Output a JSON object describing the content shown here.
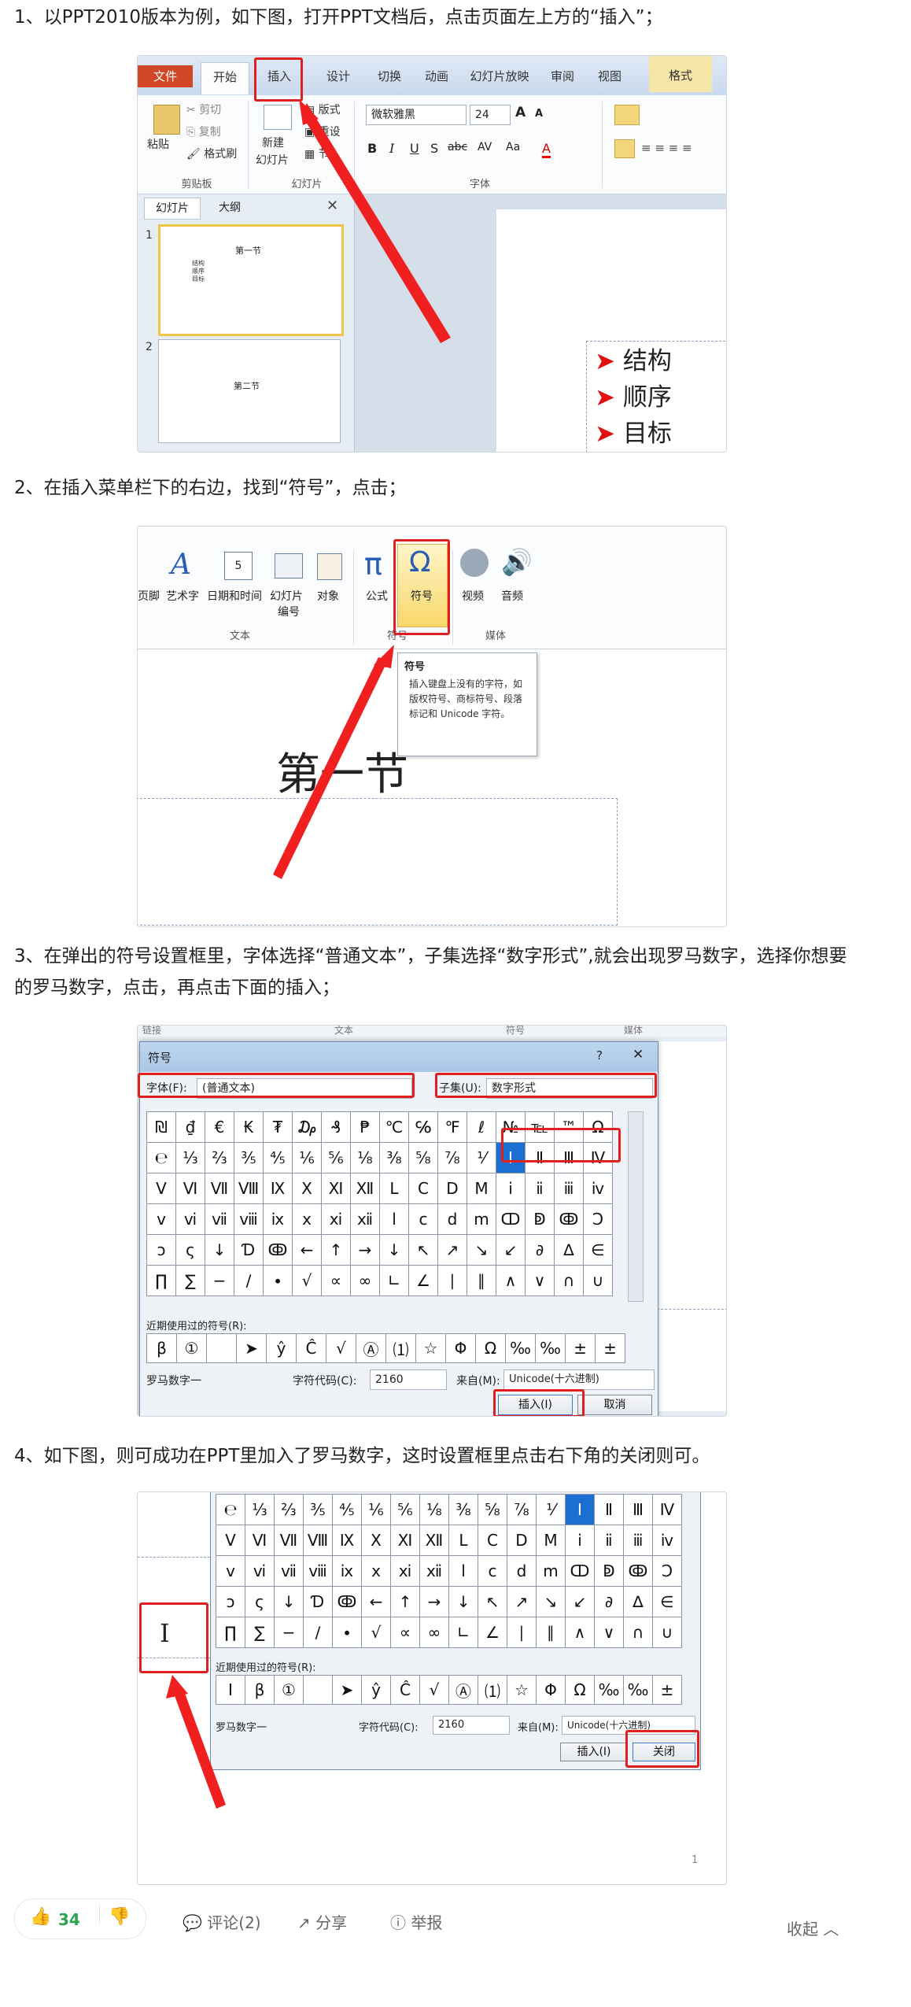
{
  "steps": [
    "1、以PPT2010版本为例，如下图，打开PPT文档后，点击页面左上方的“插入”；",
    "2、在插入菜单栏下的右边，找到“符号”，点击；",
    "3、在弹出的符号设置框里，字体选择“普通文本”，子集选择“数字形式”,就会出现罗马数字，选择你想要的罗马数字，点击，再点击下面的插入；",
    "4、如下图，则可成功在PPT里加入了罗马数字，这时设置框里点击右下角的关闭则可。"
  ],
  "shot1": {
    "tabs": [
      "文件",
      "开始",
      "插入",
      "设计",
      "切换",
      "动画",
      "幻灯片放映",
      "审阅",
      "视图",
      "格式"
    ],
    "clipboard": {
      "paste": "粘贴",
      "cut": "剪切",
      "copy": "复制",
      "format": "格式刷",
      "group": "剪贴板"
    },
    "slides_group": {
      "new": "新建",
      "new2": "幻灯片",
      "layout": "版式",
      "reset": "重设",
      "section": "节",
      "group": "幻灯片"
    },
    "font": {
      "name": "微软雅黑",
      "size": "24",
      "group": "字体",
      "grow": "A",
      "shrink": "A"
    },
    "font_buttons": [
      "B",
      "I",
      "U",
      "S",
      "abc",
      "AV",
      "Aa",
      "A"
    ],
    "panel_tabs": [
      "幻灯片",
      "大纲"
    ],
    "thumb1": {
      "num": "1",
      "title": "第一节",
      "items": [
        "结构",
        "顺序",
        "目标"
      ]
    },
    "thumb2": {
      "num": "2",
      "title": "第二节"
    },
    "bullets": [
      "结构",
      "顺序",
      "目标"
    ]
  },
  "shot2": {
    "items": [
      "页脚",
      "艺术字",
      "日期和时间",
      "幻灯片",
      "编号",
      "对象",
      "公式",
      "符号",
      "视频",
      "音频"
    ],
    "groups": [
      "文本",
      "符号",
      "媒体"
    ],
    "tooltip": {
      "title": "符号",
      "body": "插入键盘上没有的字符，如版权符号、商标符号、段落标记和 Unicode 字符。"
    },
    "slide_title": "第一节"
  },
  "shot3": {
    "top_labels": [
      "链接",
      "文本",
      "符号",
      "媒体"
    ],
    "title": "符号",
    "help": "?",
    "close": "✕",
    "font_label": "字体(F):",
    "font_value": "(普通文本)",
    "subset_label": "子集(U):",
    "subset_value": "数字形式",
    "grid": [
      [
        "₪",
        "₫",
        "€",
        "₭",
        "₮",
        "₯",
        "₰",
        "₱",
        "℃",
        "℅",
        "℉",
        "ℓ",
        "№",
        "℡",
        "™",
        "Ω"
      ],
      [
        "℮",
        "⅓",
        "⅔",
        "⅗",
        "⅘",
        "⅙",
        "⅚",
        "⅛",
        "⅜",
        "⅝",
        "⅞",
        "⅟",
        "Ⅰ",
        "Ⅱ",
        "Ⅲ",
        "Ⅳ"
      ],
      [
        "Ⅴ",
        "Ⅵ",
        "Ⅶ",
        "Ⅷ",
        "Ⅸ",
        "Ⅹ",
        "Ⅺ",
        "Ⅻ",
        "Ⅼ",
        "Ⅽ",
        "Ⅾ",
        "Ⅿ",
        "ⅰ",
        "ⅱ",
        "ⅲ",
        "ⅳ"
      ],
      [
        "ⅴ",
        "ⅵ",
        "ⅶ",
        "ⅷ",
        "ⅸ",
        "ⅹ",
        "ⅺ",
        "ⅻ",
        "ⅼ",
        "ⅽ",
        "ⅾ",
        "ⅿ",
        "ↀ",
        "ↁ",
        "ↂ",
        "Ↄ"
      ],
      [
        "ↄ",
        "ς",
        "↓",
        "Ɗ",
        "ↂ",
        "←",
        "↑",
        "→",
        "↓",
        "↖",
        "↗",
        "↘",
        "↙",
        "∂",
        "∆",
        "∈"
      ],
      [
        "∏",
        "∑",
        "−",
        "∕",
        "∙",
        "√",
        "∝",
        "∞",
        "∟",
        "∠",
        "∣",
        "∥",
        "∧",
        "∨",
        "∩",
        "∪"
      ]
    ],
    "recent_label": "近期使用过的符号(R):",
    "recent": [
      "β",
      "①",
      "",
      "➤",
      "ŷ",
      "Ĉ",
      "√",
      "Ⓐ",
      "⑴",
      "☆",
      "Φ",
      "Ω",
      "‰",
      "‰",
      "±",
      "±"
    ],
    "char_name": "罗马数字一",
    "code_label": "字符代码(C):",
    "code_value": "2160",
    "from_label": "来自(M):",
    "from_value": "Unicode(十六进制)",
    "insert_button": "插入(I)",
    "cancel_button": "取消"
  },
  "shot4": {
    "grid": [
      [
        "℮",
        "⅓",
        "⅔",
        "⅗",
        "⅘",
        "⅙",
        "⅚",
        "⅛",
        "⅜",
        "⅝",
        "⅞",
        "⅟",
        "Ⅰ",
        "Ⅱ",
        "Ⅲ",
        "Ⅳ"
      ],
      [
        "Ⅴ",
        "Ⅵ",
        "Ⅶ",
        "Ⅷ",
        "Ⅸ",
        "Ⅹ",
        "Ⅺ",
        "Ⅻ",
        "Ⅼ",
        "Ⅽ",
        "Ⅾ",
        "Ⅿ",
        "ⅰ",
        "ⅱ",
        "ⅲ",
        "ⅳ"
      ],
      [
        "ⅴ",
        "ⅵ",
        "ⅶ",
        "ⅷ",
        "ⅸ",
        "ⅹ",
        "ⅺ",
        "ⅻ",
        "ⅼ",
        "ⅽ",
        "ⅾ",
        "ⅿ",
        "ↀ",
        "ↁ",
        "ↂ",
        "Ↄ"
      ],
      [
        "ↄ",
        "ς",
        "↓",
        "Ɗ",
        "ↂ",
        "←",
        "↑",
        "→",
        "↓",
        "↖",
        "↗",
        "↘",
        "↙",
        "∂",
        "∆",
        "∈"
      ],
      [
        "∏",
        "∑",
        "−",
        "∕",
        "∙",
        "√",
        "∝",
        "∞",
        "∟",
        "∠",
        "∣",
        "∥",
        "∧",
        "∨",
        "∩",
        "∪"
      ]
    ],
    "recent_label": "近期使用过的符号(R):",
    "recent": [
      "Ⅰ",
      "β",
      "①",
      "",
      "➤",
      "ŷ",
      "Ĉ",
      "√",
      "Ⓐ",
      "⑴",
      "☆",
      "Φ",
      "Ω",
      "‰",
      "‰",
      "±"
    ],
    "char_name": "罗马数字一",
    "code_label": "字符代码(C):",
    "code_value": "2160",
    "from_label": "来自(M):",
    "from_value": "Unicode(十六进制)",
    "insert_button": "插入(I)",
    "close_button": "关闭",
    "inserted": "Ⅰ",
    "page_num": "1"
  },
  "footer": {
    "likes": "34",
    "comment": "评论(2)",
    "share": "分享",
    "report": "举报",
    "collapse": "收起"
  }
}
